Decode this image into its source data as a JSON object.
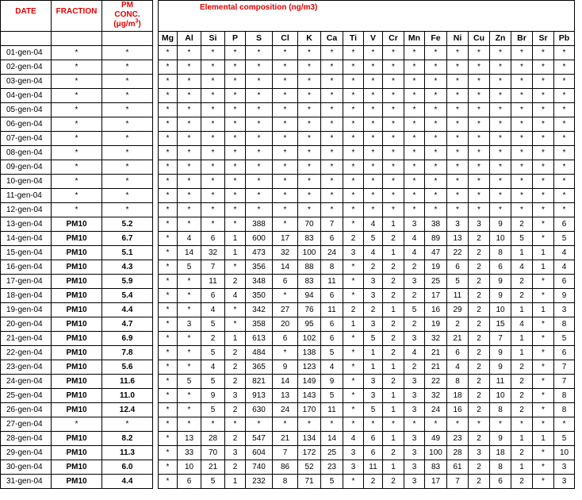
{
  "headers": {
    "date": "DATE",
    "fraction": "FRACTION",
    "pm_conc_line1": "PM",
    "pm_conc_line2": "CONC.",
    "pm_conc_unit": "(μg/m",
    "pm_conc_unit_sup": "3",
    "pm_conc_unit_close": ")",
    "elemental": "Elemental composition (ng/m3)"
  },
  "elements": [
    "Mg",
    "Al",
    "Si",
    "P",
    "S",
    "Cl",
    "K",
    "Ca",
    "Ti",
    "V",
    "Cr",
    "Mn",
    "Fe",
    "Ni",
    "Cu",
    "Zn",
    "Br",
    "Sr",
    "Pb"
  ],
  "rows": [
    {
      "date": "01-gen-04",
      "fraction": "*",
      "pm": "*",
      "values": [
        "*",
        "*",
        "*",
        "*",
        "*",
        "*",
        "*",
        "*",
        "*",
        "*",
        "*",
        "*",
        "*",
        "*",
        "*",
        "*",
        "*",
        "*",
        "*"
      ]
    },
    {
      "date": "02-gen-04",
      "fraction": "*",
      "pm": "*",
      "values": [
        "*",
        "*",
        "*",
        "*",
        "*",
        "*",
        "*",
        "*",
        "*",
        "*",
        "*",
        "*",
        "*",
        "*",
        "*",
        "*",
        "*",
        "*",
        "*"
      ]
    },
    {
      "date": "03-gen-04",
      "fraction": "*",
      "pm": "*",
      "values": [
        "*",
        "*",
        "*",
        "*",
        "*",
        "*",
        "*",
        "*",
        "*",
        "*",
        "*",
        "*",
        "*",
        "*",
        "*",
        "*",
        "*",
        "*",
        "*"
      ]
    },
    {
      "date": "04-gen-04",
      "fraction": "*",
      "pm": "*",
      "values": [
        "*",
        "*",
        "*",
        "*",
        "*",
        "*",
        "*",
        "*",
        "*",
        "*",
        "*",
        "*",
        "*",
        "*",
        "*",
        "*",
        "*",
        "*",
        "*"
      ]
    },
    {
      "date": "05-gen-04",
      "fraction": "*",
      "pm": "*",
      "values": [
        "*",
        "*",
        "*",
        "*",
        "*",
        "*",
        "*",
        "*",
        "*",
        "*",
        "*",
        "*",
        "*",
        "*",
        "*",
        "*",
        "*",
        "*",
        "*"
      ]
    },
    {
      "date": "06-gen-04",
      "fraction": "*",
      "pm": "*",
      "values": [
        "*",
        "*",
        "*",
        "*",
        "*",
        "*",
        "*",
        "*",
        "*",
        "*",
        "*",
        "*",
        "*",
        "*",
        "*",
        "*",
        "*",
        "*",
        "*"
      ]
    },
    {
      "date": "07-gen-04",
      "fraction": "*",
      "pm": "*",
      "values": [
        "*",
        "*",
        "*",
        "*",
        "*",
        "*",
        "*",
        "*",
        "*",
        "*",
        "*",
        "*",
        "*",
        "*",
        "*",
        "*",
        "*",
        "*",
        "*"
      ]
    },
    {
      "date": "08-gen-04",
      "fraction": "*",
      "pm": "*",
      "values": [
        "*",
        "*",
        "*",
        "*",
        "*",
        "*",
        "*",
        "*",
        "*",
        "*",
        "*",
        "*",
        "*",
        "*",
        "*",
        "*",
        "*",
        "*",
        "*"
      ]
    },
    {
      "date": "09-gen-04",
      "fraction": "*",
      "pm": "*",
      "values": [
        "*",
        "*",
        "*",
        "*",
        "*",
        "*",
        "*",
        "*",
        "*",
        "*",
        "*",
        "*",
        "*",
        "*",
        "*",
        "*",
        "*",
        "*",
        "*"
      ]
    },
    {
      "date": "10-gen-04",
      "fraction": "*",
      "pm": "*",
      "values": [
        "*",
        "*",
        "*",
        "*",
        "*",
        "*",
        "*",
        "*",
        "*",
        "*",
        "*",
        "*",
        "*",
        "*",
        "*",
        "*",
        "*",
        "*",
        "*"
      ]
    },
    {
      "date": "11-gen-04",
      "fraction": "*",
      "pm": "*",
      "values": [
        "*",
        "*",
        "*",
        "*",
        "*",
        "*",
        "*",
        "*",
        "*",
        "*",
        "*",
        "*",
        "*",
        "*",
        "*",
        "*",
        "*",
        "*",
        "*"
      ]
    },
    {
      "date": "12-gen-04",
      "fraction": "*",
      "pm": "*",
      "values": [
        "*",
        "*",
        "*",
        "*",
        "*",
        "*",
        "*",
        "*",
        "*",
        "*",
        "*",
        "*",
        "*",
        "*",
        "*",
        "*",
        "*",
        "*",
        "*"
      ]
    },
    {
      "date": "13-gen-04",
      "fraction": "PM10",
      "pm": "5.2",
      "values": [
        "*",
        "*",
        "*",
        "*",
        "388",
        "*",
        "70",
        "7",
        "*",
        "4",
        "1",
        "3",
        "38",
        "3",
        "3",
        "9",
        "2",
        "*",
        "6"
      ]
    },
    {
      "date": "14-gen-04",
      "fraction": "PM10",
      "pm": "6.7",
      "values": [
        "*",
        "4",
        "6",
        "1",
        "600",
        "17",
        "83",
        "6",
        "2",
        "5",
        "2",
        "4",
        "89",
        "13",
        "2",
        "10",
        "5",
        "*",
        "5"
      ]
    },
    {
      "date": "15-gen-04",
      "fraction": "PM10",
      "pm": "5.1",
      "values": [
        "*",
        "14",
        "32",
        "1",
        "473",
        "32",
        "100",
        "24",
        "3",
        "4",
        "1",
        "4",
        "47",
        "22",
        "2",
        "8",
        "1",
        "1",
        "4"
      ]
    },
    {
      "date": "16-gen-04",
      "fraction": "PM10",
      "pm": "4.3",
      "values": [
        "*",
        "5",
        "7",
        "*",
        "356",
        "14",
        "88",
        "8",
        "*",
        "2",
        "2",
        "2",
        "19",
        "6",
        "2",
        "6",
        "4",
        "1",
        "4"
      ]
    },
    {
      "date": "17-gen-04",
      "fraction": "PM10",
      "pm": "5.9",
      "values": [
        "*",
        "*",
        "11",
        "2",
        "348",
        "6",
        "83",
        "11",
        "*",
        "3",
        "2",
        "3",
        "25",
        "5",
        "2",
        "9",
        "2",
        "*",
        "6"
      ]
    },
    {
      "date": "18-gen-04",
      "fraction": "PM10",
      "pm": "5.4",
      "values": [
        "*",
        "*",
        "6",
        "4",
        "350",
        "*",
        "94",
        "6",
        "*",
        "3",
        "2",
        "2",
        "17",
        "11",
        "2",
        "9",
        "2",
        "*",
        "9"
      ]
    },
    {
      "date": "19-gen-04",
      "fraction": "PM10",
      "pm": "4.4",
      "values": [
        "*",
        "*",
        "4",
        "*",
        "342",
        "27",
        "76",
        "11",
        "2",
        "2",
        "1",
        "5",
        "16",
        "29",
        "2",
        "10",
        "1",
        "1",
        "3"
      ]
    },
    {
      "date": "20-gen-04",
      "fraction": "PM10",
      "pm": "4.7",
      "values": [
        "*",
        "3",
        "5",
        "*",
        "358",
        "20",
        "95",
        "6",
        "1",
        "3",
        "2",
        "2",
        "19",
        "2",
        "2",
        "15",
        "4",
        "*",
        "8"
      ]
    },
    {
      "date": "21-gen-04",
      "fraction": "PM10",
      "pm": "6.9",
      "values": [
        "*",
        "*",
        "2",
        "1",
        "613",
        "6",
        "102",
        "6",
        "*",
        "5",
        "2",
        "3",
        "32",
        "21",
        "2",
        "7",
        "1",
        "*",
        "5"
      ]
    },
    {
      "date": "22-gen-04",
      "fraction": "PM10",
      "pm": "7.8",
      "values": [
        "*",
        "*",
        "5",
        "2",
        "484",
        "*",
        "138",
        "5",
        "*",
        "1",
        "2",
        "4",
        "21",
        "6",
        "2",
        "9",
        "1",
        "*",
        "6"
      ]
    },
    {
      "date": "23-gen-04",
      "fraction": "PM10",
      "pm": "5.6",
      "values": [
        "*",
        "*",
        "4",
        "2",
        "365",
        "9",
        "123",
        "4",
        "*",
        "1",
        "1",
        "2",
        "21",
        "4",
        "2",
        "9",
        "2",
        "*",
        "7"
      ]
    },
    {
      "date": "24-gen-04",
      "fraction": "PM10",
      "pm": "11.6",
      "values": [
        "*",
        "5",
        "5",
        "2",
        "821",
        "14",
        "149",
        "9",
        "*",
        "3",
        "2",
        "3",
        "22",
        "8",
        "2",
        "11",
        "2",
        "*",
        "7"
      ]
    },
    {
      "date": "25-gen-04",
      "fraction": "PM10",
      "pm": "11.0",
      "values": [
        "*",
        "*",
        "9",
        "3",
        "913",
        "13",
        "143",
        "5",
        "*",
        "3",
        "1",
        "3",
        "32",
        "18",
        "2",
        "10",
        "2",
        "*",
        "8"
      ]
    },
    {
      "date": "26-gen-04",
      "fraction": "PM10",
      "pm": "12.4",
      "values": [
        "*",
        "*",
        "5",
        "2",
        "630",
        "24",
        "170",
        "11",
        "*",
        "5",
        "1",
        "3",
        "24",
        "16",
        "2",
        "8",
        "2",
        "*",
        "8"
      ]
    },
    {
      "date": "27-gen-04",
      "fraction": "*",
      "pm": "*",
      "values": [
        "*",
        "*",
        "*",
        "*",
        "*",
        "*",
        "*",
        "*",
        "*",
        "*",
        "*",
        "*",
        "*",
        "*",
        "*",
        "*",
        "*",
        "*",
        "*"
      ]
    },
    {
      "date": "28-gen-04",
      "fraction": "PM10",
      "pm": "8.2",
      "values": [
        "*",
        "13",
        "28",
        "2",
        "547",
        "21",
        "134",
        "14",
        "4",
        "6",
        "1",
        "3",
        "49",
        "23",
        "2",
        "9",
        "1",
        "1",
        "5"
      ]
    },
    {
      "date": "29-gen-04",
      "fraction": "PM10",
      "pm": "11.3",
      "values": [
        "*",
        "33",
        "70",
        "3",
        "604",
        "7",
        "172",
        "25",
        "3",
        "6",
        "2",
        "3",
        "100",
        "28",
        "3",
        "18",
        "2",
        "*",
        "10"
      ]
    },
    {
      "date": "30-gen-04",
      "fraction": "PM10",
      "pm": "6.0",
      "values": [
        "*",
        "10",
        "21",
        "2",
        "740",
        "86",
        "52",
        "23",
        "3",
        "11",
        "1",
        "3",
        "83",
        "61",
        "2",
        "8",
        "1",
        "*",
        "3"
      ]
    },
    {
      "date": "31-gen-04",
      "fraction": "PM10",
      "pm": "4.4",
      "values": [
        "*",
        "6",
        "5",
        "1",
        "232",
        "8",
        "71",
        "5",
        "*",
        "2",
        "2",
        "3",
        "17",
        "7",
        "2",
        "6",
        "2",
        "*",
        "3"
      ]
    }
  ]
}
